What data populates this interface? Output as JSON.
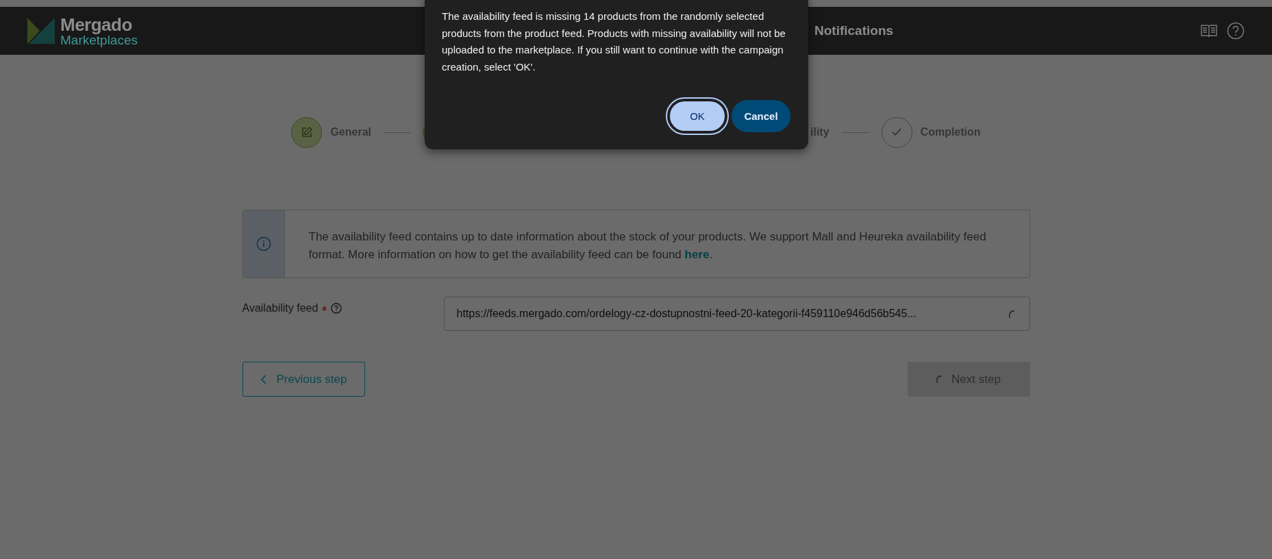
{
  "header": {
    "logo": {
      "title": "Mergado",
      "subtitle": "Marketplaces"
    },
    "notifications": "Notifications"
  },
  "stepper": [
    {
      "kind": "circle-label",
      "label": "General",
      "completed": true
    },
    {
      "kind": "circle",
      "completed": true
    },
    {
      "kind": "label",
      "label": "ility"
    },
    {
      "kind": "circle-label",
      "label": "Completion",
      "completed": false
    }
  ],
  "info": {
    "text": "The availability feed contains up to date information about the stock of your products. We support Mall and Heureka availability feed format. More information on how to get the availability feed can be found ",
    "link": "here",
    "after": "."
  },
  "field": {
    "label": "Availability feed",
    "required": true,
    "value": "https://feeds.mergado.com/ordelogy-cz-dostupnostni-feed-20-kategorii-f459110e946d56b545...",
    "loading": true
  },
  "previous": "Previous step",
  "next": {
    "label": "Next step",
    "disabled": true,
    "loading": true
  },
  "dialog": {
    "message": "The availability feed is missing 14 products from the randomly selected products from the product feed. Products with missing availability will not be uploaded to the marketplace. If you still want to continue with the campaign creation, select 'OK'.",
    "buttons": [
      {
        "label": "OK",
        "kind": "primary",
        "focused": true
      },
      {
        "label": "Cancel",
        "kind": "secondary",
        "focused": false
      }
    ]
  }
}
